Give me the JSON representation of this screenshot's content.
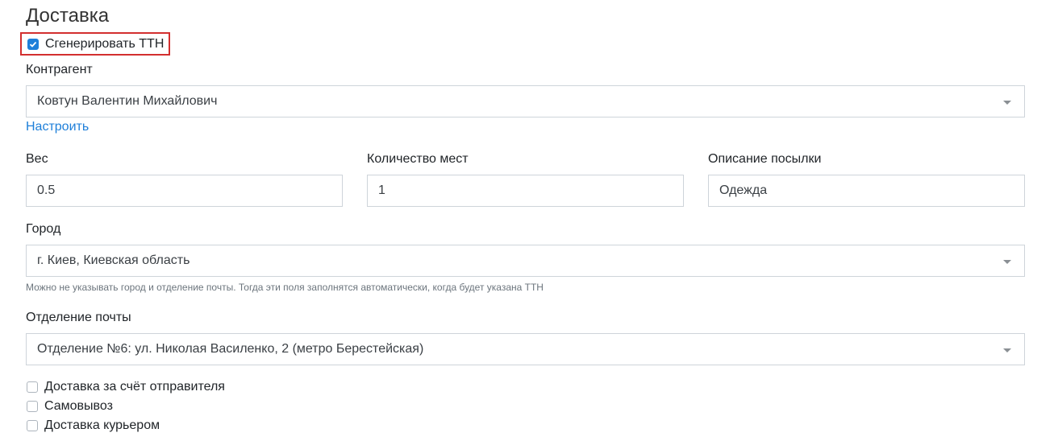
{
  "section_title": "Доставка",
  "generate_ttn": {
    "label": "Сгенерировать ТТН",
    "checked": true
  },
  "counterparty": {
    "label": "Контрагент",
    "value": "Ковтун Валентин Михайлович",
    "configure_link": "Настроить"
  },
  "weight": {
    "label": "Вес",
    "value": "0.5"
  },
  "places": {
    "label": "Количество мест",
    "value": "1"
  },
  "description": {
    "label": "Описание посылки",
    "value": "Одежда"
  },
  "city": {
    "label": "Город",
    "value": "г. Киев, Киевская область",
    "hint": "Можно не указывать город и отделение почты. Тогда эти поля заполнятся автоматически, когда будет указана ТТН"
  },
  "branch": {
    "label": "Отделение почты",
    "value": "Отделение №6: ул. Николая Василенко, 2 (метро Берестейская)"
  },
  "options": [
    {
      "label": "Доставка за счёт отправителя",
      "checked": false
    },
    {
      "label": "Самовывоз",
      "checked": false
    },
    {
      "label": "Доставка курьером",
      "checked": false
    }
  ],
  "colors": {
    "accent": "#1e7fd9",
    "highlight_border": "#d32f2f"
  }
}
